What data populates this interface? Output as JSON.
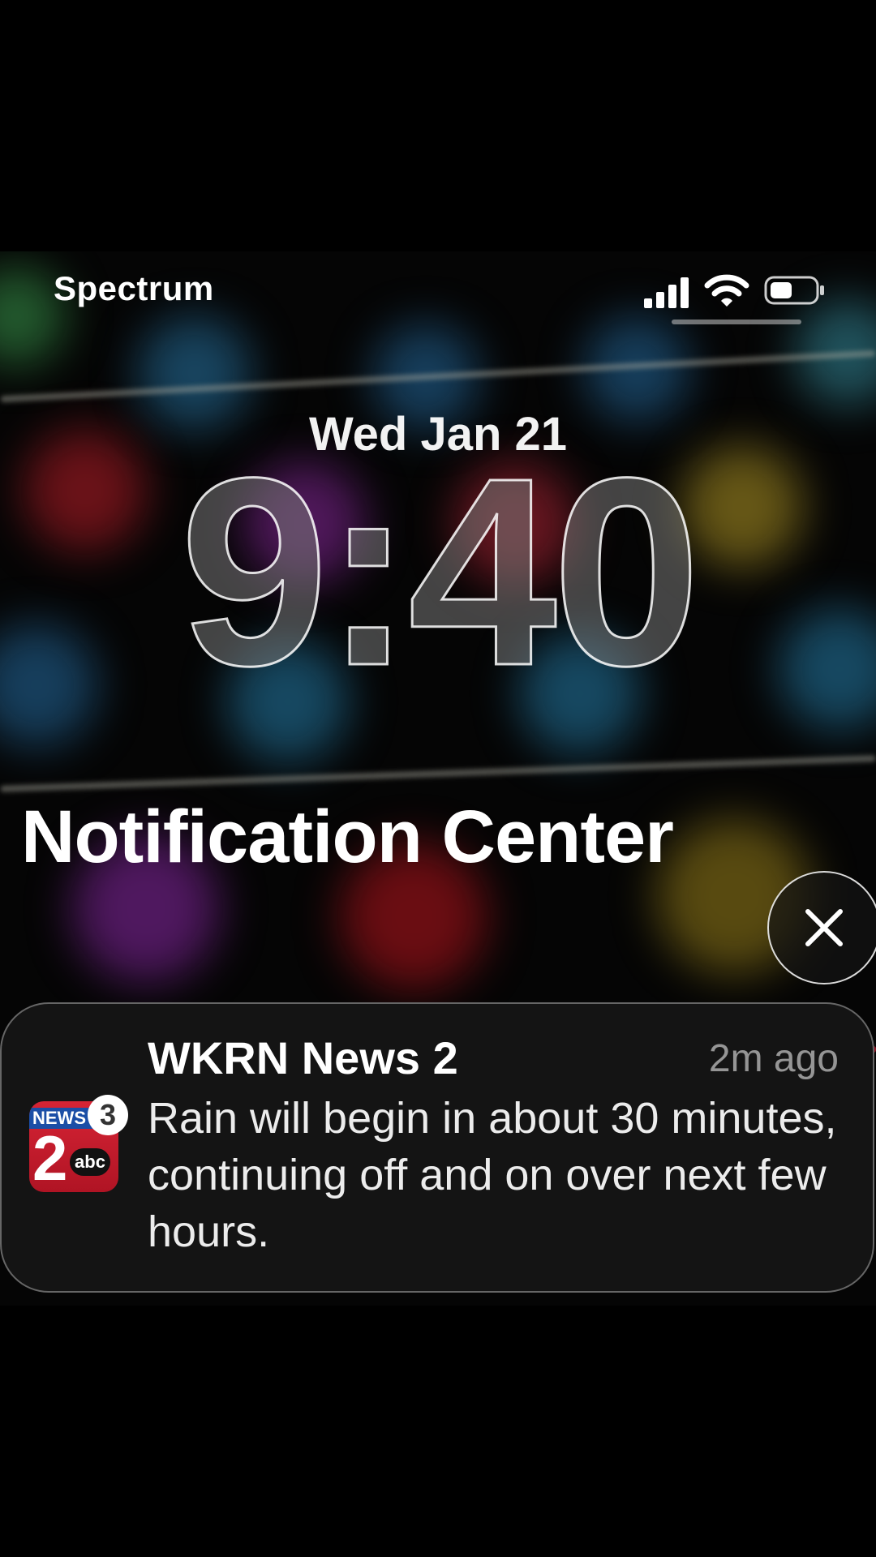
{
  "status_bar": {
    "carrier": "Spectrum",
    "icons": [
      "signal-icon",
      "wifi-icon",
      "battery-icon"
    ]
  },
  "lock_screen": {
    "date": "Wed Jan 21",
    "time": "9:40"
  },
  "notification_center": {
    "title": "Notification Center",
    "close_icon": "close-icon"
  },
  "notification": {
    "app_name": "WKRN News 2",
    "timestamp": "2m ago",
    "message": "Rain will begin in about 30 minutes, continuing off and on over next few hours.",
    "badge_count": "3",
    "icon": {
      "band_text": "NEWS",
      "number": "2",
      "network": "abc"
    }
  },
  "colors": {
    "background": "#000000",
    "notification_bg": "#141414",
    "icon_red": "#d62435",
    "icon_blue": "#1b4ea6"
  }
}
